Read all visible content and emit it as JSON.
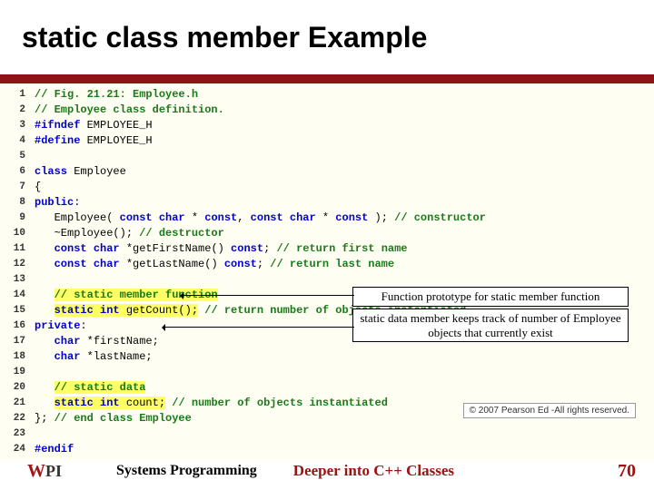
{
  "title": {
    "highlight": "static",
    "rest": " class member Example"
  },
  "code": [
    {
      "n": "1",
      "tokens": [
        {
          "c": "cmt",
          "t": "// Fig. 21.21: Employee.h"
        }
      ]
    },
    {
      "n": "2",
      "tokens": [
        {
          "c": "cmt",
          "t": "// Employee class definition."
        }
      ]
    },
    {
      "n": "3",
      "tokens": [
        {
          "c": "pp",
          "t": "#ifndef "
        },
        {
          "c": "id",
          "t": "EMPLOYEE_H"
        }
      ]
    },
    {
      "n": "4",
      "tokens": [
        {
          "c": "pp",
          "t": "#define "
        },
        {
          "c": "id",
          "t": "EMPLOYEE_H"
        }
      ]
    },
    {
      "n": "5",
      "tokens": []
    },
    {
      "n": "6",
      "tokens": [
        {
          "c": "kw",
          "t": "class "
        },
        {
          "c": "id",
          "t": "Employee"
        }
      ]
    },
    {
      "n": "7",
      "tokens": [
        {
          "c": "id",
          "t": "{"
        }
      ]
    },
    {
      "n": "8",
      "tokens": [
        {
          "c": "kw",
          "t": "public"
        },
        {
          "c": "id",
          "t": ":"
        }
      ]
    },
    {
      "n": "9",
      "tokens": [
        {
          "c": "id",
          "t": "   Employee( "
        },
        {
          "c": "kw",
          "t": "const char"
        },
        {
          "c": "id",
          "t": " * "
        },
        {
          "c": "kw",
          "t": "const"
        },
        {
          "c": "id",
          "t": ", "
        },
        {
          "c": "kw",
          "t": "const char"
        },
        {
          "c": "id",
          "t": " * "
        },
        {
          "c": "kw",
          "t": "const"
        },
        {
          "c": "id",
          "t": " ); "
        },
        {
          "c": "cmt",
          "t": "// constructor"
        }
      ]
    },
    {
      "n": "10",
      "tokens": [
        {
          "c": "id",
          "t": "   ~Employee(); "
        },
        {
          "c": "cmt",
          "t": "// destructor"
        }
      ]
    },
    {
      "n": "11",
      "tokens": [
        {
          "c": "id",
          "t": "   "
        },
        {
          "c": "kw",
          "t": "const char"
        },
        {
          "c": "id",
          "t": " *getFirstName() "
        },
        {
          "c": "kw",
          "t": "const"
        },
        {
          "c": "id",
          "t": "; "
        },
        {
          "c": "cmt",
          "t": "// return first name"
        }
      ]
    },
    {
      "n": "12",
      "tokens": [
        {
          "c": "id",
          "t": "   "
        },
        {
          "c": "kw",
          "t": "const char"
        },
        {
          "c": "id",
          "t": " *getLastName() "
        },
        {
          "c": "kw",
          "t": "const"
        },
        {
          "c": "id",
          "t": "; "
        },
        {
          "c": "cmt",
          "t": "// return last name"
        }
      ]
    },
    {
      "n": "13",
      "tokens": []
    },
    {
      "n": "14",
      "tokens": [
        {
          "c": "id",
          "t": "   "
        },
        {
          "c": "cmt hlbg",
          "t": "// static member function"
        }
      ]
    },
    {
      "n": "15",
      "tokens": [
        {
          "c": "id",
          "t": "   "
        },
        {
          "c": "kw hlbg",
          "t": "static int"
        },
        {
          "c": "id hlbg",
          "t": " getCount();"
        },
        {
          "c": "id",
          "t": " "
        },
        {
          "c": "cmt",
          "t": "// return number of objects instantiated"
        }
      ]
    },
    {
      "n": "16",
      "tokens": [
        {
          "c": "kw",
          "t": "private"
        },
        {
          "c": "id",
          "t": ":"
        }
      ]
    },
    {
      "n": "17",
      "tokens": [
        {
          "c": "id",
          "t": "   "
        },
        {
          "c": "kw",
          "t": "char"
        },
        {
          "c": "id",
          "t": " *firstName;"
        }
      ]
    },
    {
      "n": "18",
      "tokens": [
        {
          "c": "id",
          "t": "   "
        },
        {
          "c": "kw",
          "t": "char"
        },
        {
          "c": "id",
          "t": " *lastName;"
        }
      ]
    },
    {
      "n": "19",
      "tokens": []
    },
    {
      "n": "20",
      "tokens": [
        {
          "c": "id",
          "t": "   "
        },
        {
          "c": "cmt hlbg",
          "t": "// static data"
        }
      ]
    },
    {
      "n": "21",
      "tokens": [
        {
          "c": "id",
          "t": "   "
        },
        {
          "c": "kw hlbg",
          "t": "static int"
        },
        {
          "c": "id hlbg",
          "t": " count;"
        },
        {
          "c": "id",
          "t": " "
        },
        {
          "c": "cmt",
          "t": "// number of objects instantiated"
        }
      ]
    },
    {
      "n": "22",
      "tokens": [
        {
          "c": "id",
          "t": "}; "
        },
        {
          "c": "cmt",
          "t": "// end class Employee"
        }
      ]
    },
    {
      "n": "23",
      "tokens": []
    },
    {
      "n": "24",
      "tokens": [
        {
          "c": "pp",
          "t": "#endif"
        }
      ]
    }
  ],
  "annotations": {
    "a1": "Function prototype for static member function",
    "a2": "static data member keeps track of number of Employee objects that currently exist"
  },
  "copyright": "© 2007 Pearson Ed -All rights reserved.",
  "footer": {
    "logo_w": "W",
    "logo_pi": "PI",
    "left": "Systems Programming",
    "center": "Deeper into C++ Classes",
    "page": "70"
  }
}
